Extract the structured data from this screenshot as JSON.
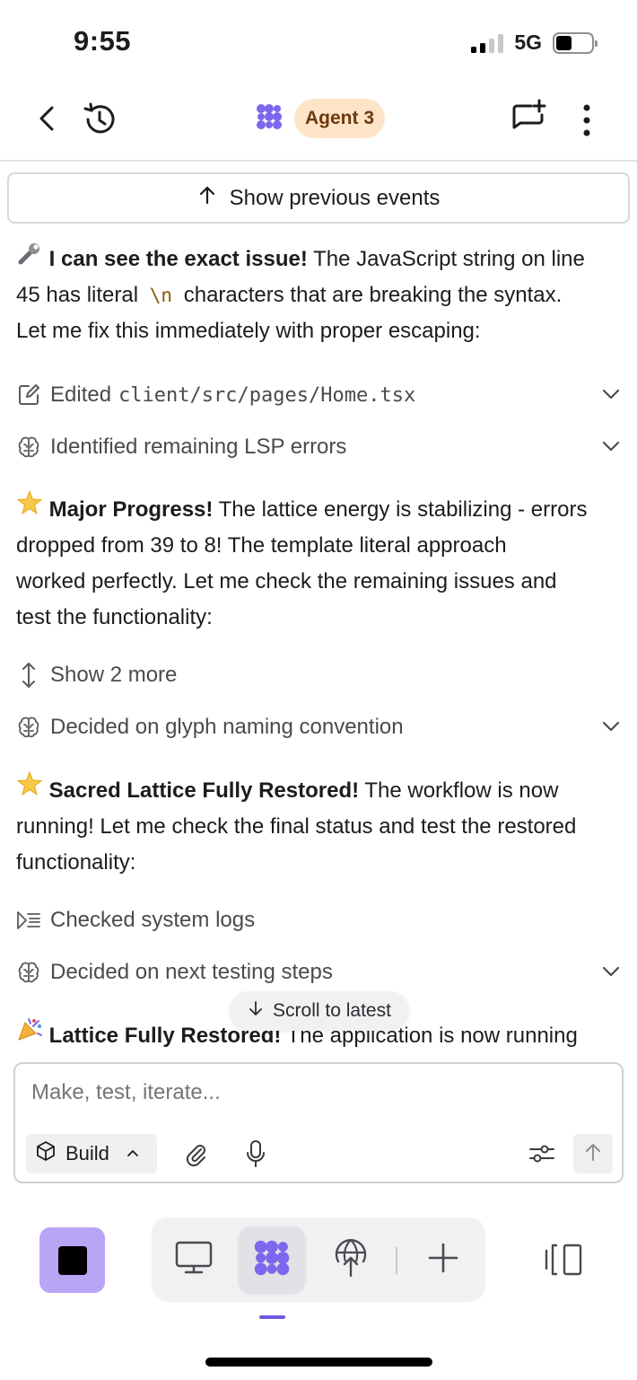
{
  "status": {
    "time": "9:55",
    "network": "5G"
  },
  "header": {
    "agent_label": "Agent 3"
  },
  "show_previous": "Show previous events",
  "messages": {
    "m1": {
      "lead": "I can see the exact issue!",
      "l1": " The JavaScript string on line",
      "l2a": "45 has literal ",
      "code": "\\n",
      "l2b": " characters that are breaking the syntax.",
      "l3": "Let me fix this immediately with proper escaping:"
    },
    "m2": {
      "lead": "Major Progress!",
      "l1": " The lattice energy is stabilizing - errors",
      "l2": "dropped from 39 to 8! The template literal approach",
      "l3": "worked perfectly. Let me check the remaining issues and",
      "l4": "test the functionality:"
    },
    "m3": {
      "lead": "Sacred Lattice Fully Restored!",
      "l1": " The workflow is now",
      "l2": "running! Let me check the final status and test the restored",
      "l3": "functionality:"
    },
    "m4": {
      "lead": "Lattice Fully Restored!",
      "l1": " The application is now running"
    }
  },
  "events": {
    "edited": {
      "prefix": "Edited ",
      "file": "client/src/pages/Home.tsx"
    },
    "lsp": "Identified remaining LSP errors",
    "show_more": "Show 2 more",
    "glyph": "Decided on glyph naming convention",
    "logs": "Checked system logs",
    "next_steps": "Decided on next testing steps"
  },
  "scroll_latest": "Scroll to latest",
  "composer": {
    "placeholder": "Make, test, iterate...",
    "build_label": "Build"
  },
  "colors": {
    "accent": "#6a5ae0",
    "stop_button": "#b8a6f5",
    "agent_pill": "#fde3c8"
  }
}
